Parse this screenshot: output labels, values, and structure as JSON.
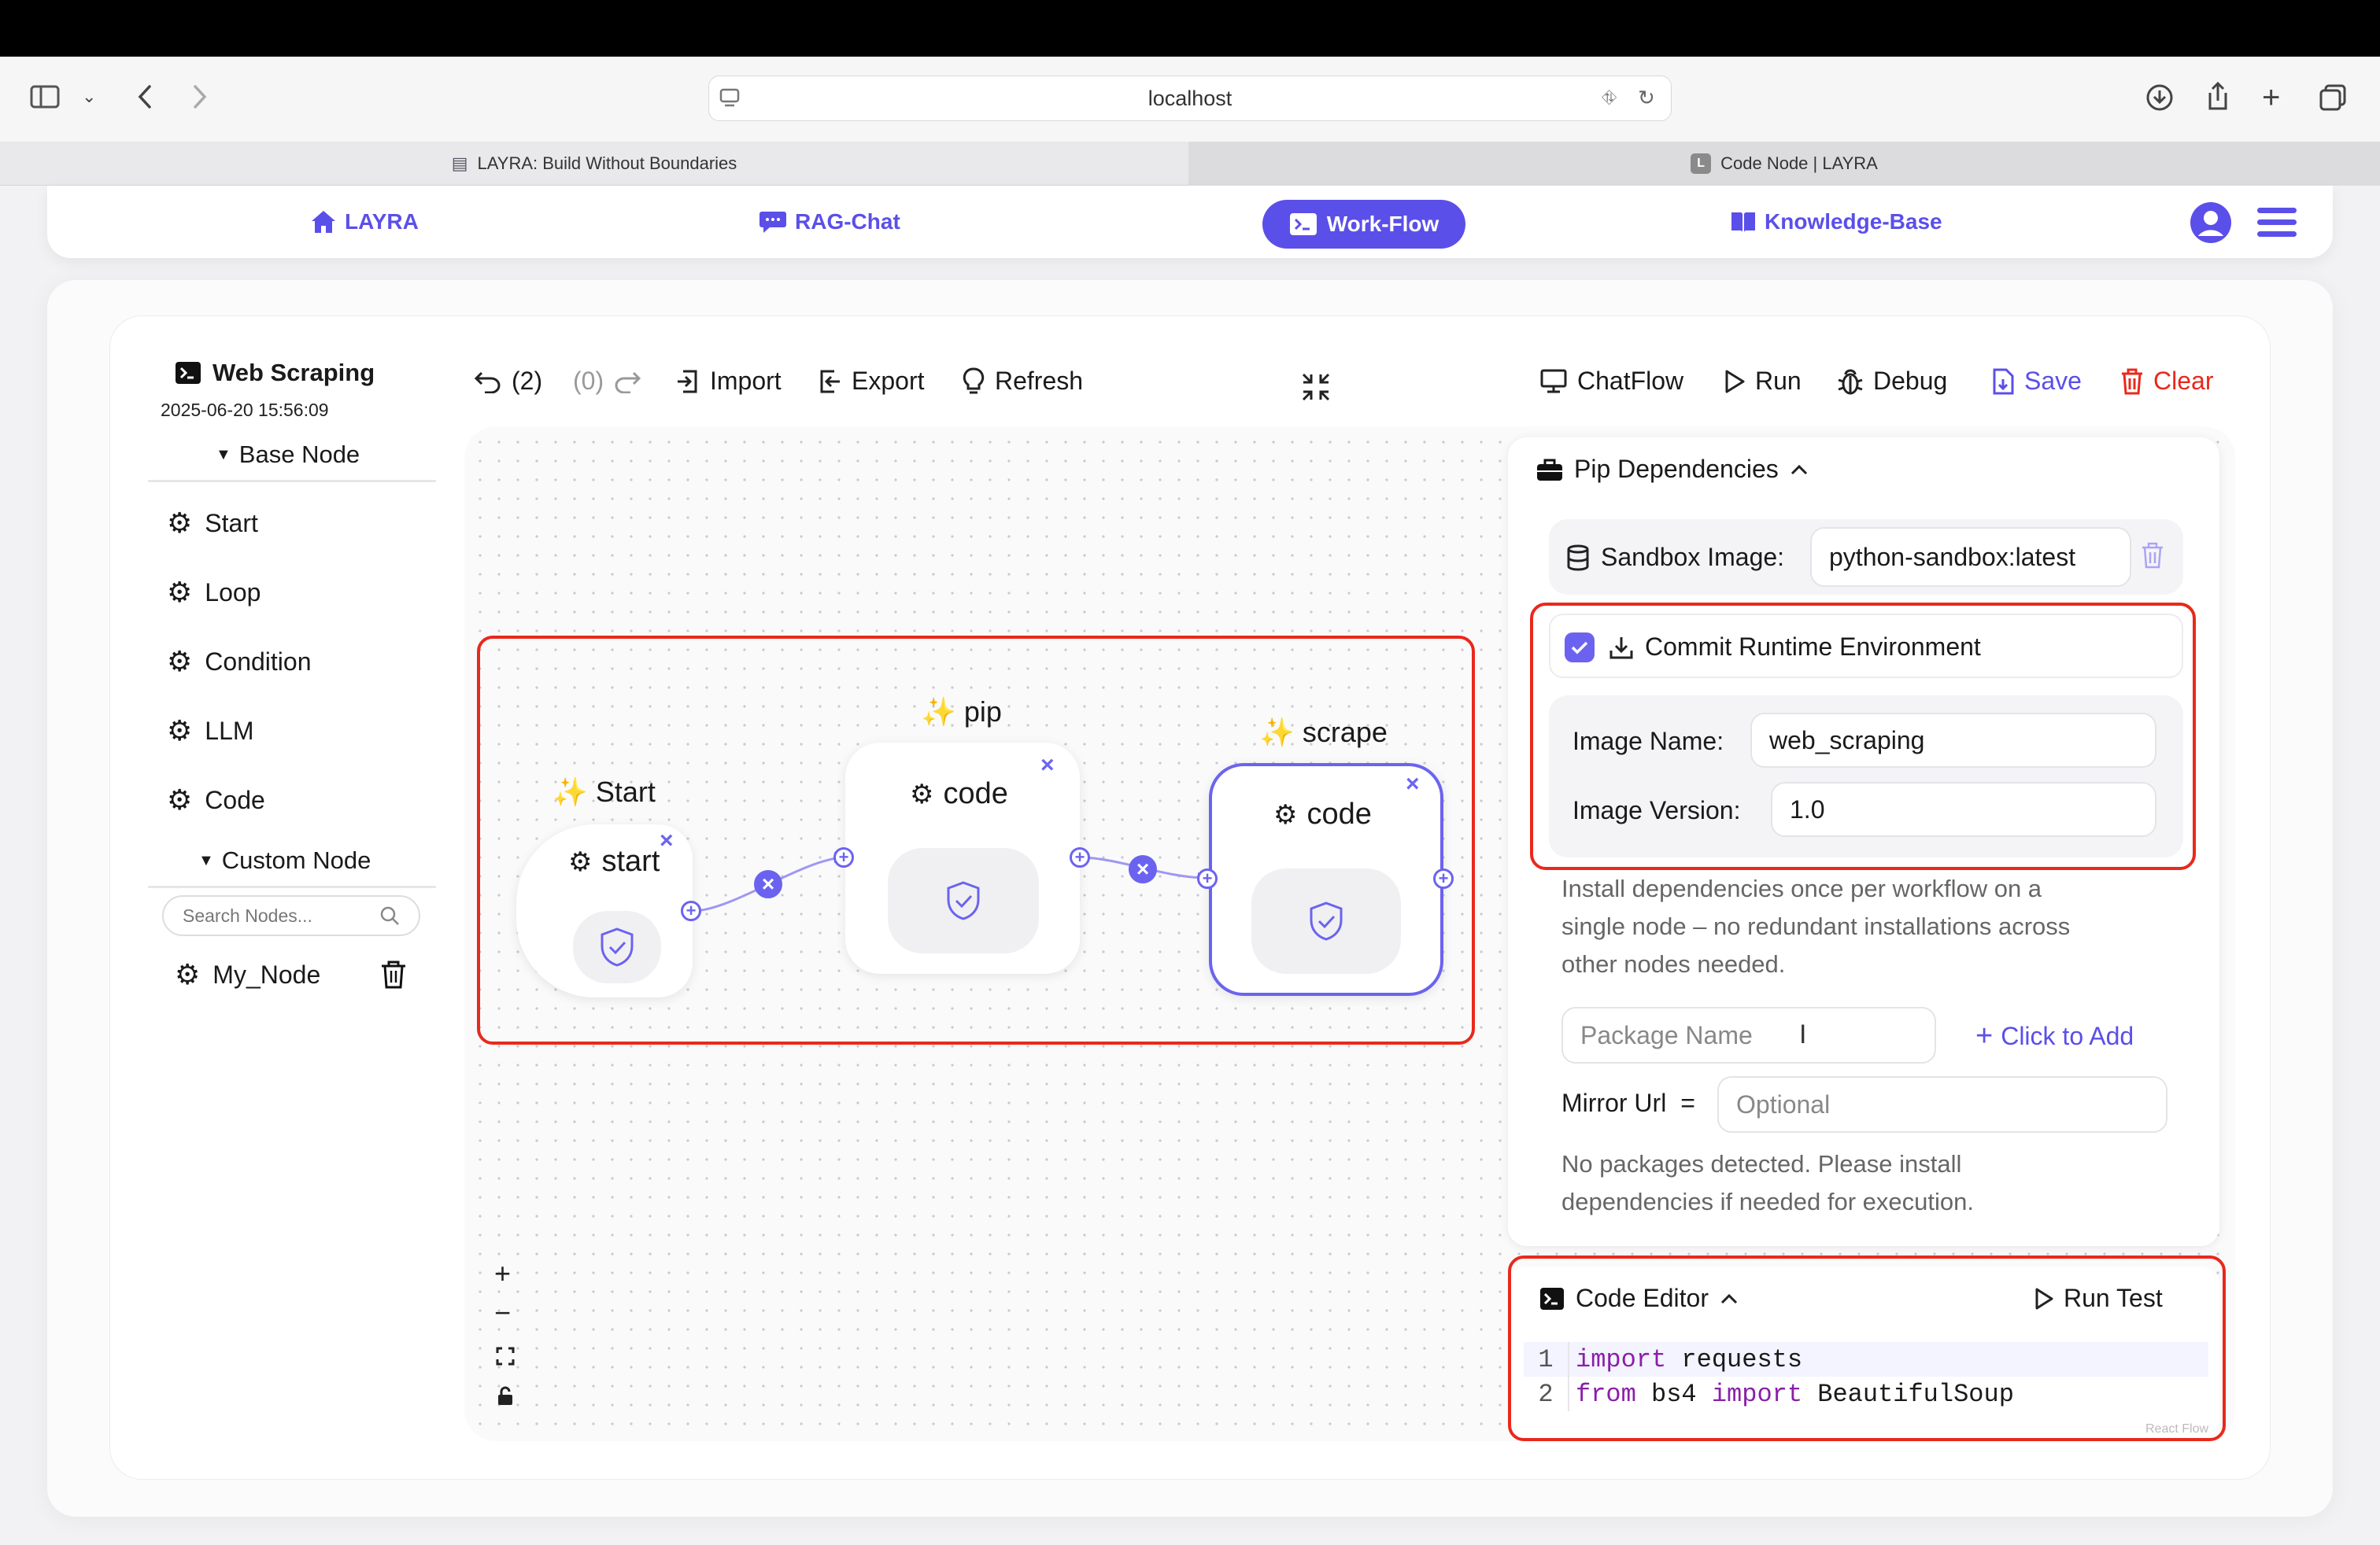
{
  "browser": {
    "url": "localhost",
    "tabs": [
      {
        "label": "LAYRA: Build Without Boundaries"
      },
      {
        "label": "Code Node | LAYRA",
        "favicon": "L"
      }
    ]
  },
  "nav": {
    "items": [
      {
        "label": "LAYRA",
        "icon": "home-icon"
      },
      {
        "label": "RAG-Chat",
        "icon": "chat-icon"
      },
      {
        "label": "Work-Flow",
        "icon": "terminal-icon",
        "active": true
      },
      {
        "label": "Knowledge-Base",
        "icon": "book-icon"
      }
    ],
    "accent": "#5b4fe9"
  },
  "sidebar": {
    "workflow_title": "Web Scraping",
    "timestamp": "2025-06-20 15:56:09",
    "base_section": "Base Node",
    "base_nodes": [
      "Start",
      "Loop",
      "Condition",
      "LLM",
      "Code"
    ],
    "custom_section": "Custom Node",
    "search_placeholder": "Search Nodes...",
    "custom_nodes": [
      "My_Node"
    ]
  },
  "toolbar": {
    "undo": "(2)",
    "redo": "(0)",
    "import": "Import",
    "export": "Export",
    "refresh": "Refresh",
    "chatflow": "ChatFlow",
    "run": "Run",
    "debug": "Debug",
    "save": "Save",
    "clear": "Clear",
    "clear_color": "#e8291c"
  },
  "graph": {
    "nodes": [
      {
        "title": "Start",
        "name": "start"
      },
      {
        "title": "pip",
        "name": "code"
      },
      {
        "title": "scrape",
        "name": "code",
        "selected": true
      }
    ]
  },
  "zoom_controls": {
    "zoom_in": "+",
    "zoom_out": "−"
  },
  "pip_panel": {
    "title": "Pip Dependencies",
    "sandbox_label": "Sandbox Image:",
    "sandbox_value": "python-sandbox:latest",
    "commit_label": "Commit Runtime Environment",
    "commit_checked": true,
    "image_name_label": "Image Name:",
    "image_name_value": "web_scraping",
    "image_version_label": "Image Version:",
    "image_version_value": "1.0",
    "hint_lines": [
      "Install dependencies once per workflow on a",
      "single node – no redundant installations across",
      "other nodes needed."
    ],
    "package_placeholder": "Package Name",
    "add_label": "Click to Add",
    "mirror_label": "Mirror Url",
    "mirror_eq": "=",
    "mirror_placeholder": "Optional",
    "empty_lines": [
      "No packages detected. Please install",
      "dependencies if needed for execution."
    ]
  },
  "code_editor": {
    "title": "Code Editor",
    "run_test": "Run Test",
    "lines": [
      {
        "no": "1",
        "kw1": "import",
        "rest1": " requests",
        "kw2": "",
        "rest2": ""
      },
      {
        "no": "2",
        "kw1": "from",
        "rest1": " bs4 ",
        "kw2": "import",
        "rest2": " BeautifulSoup"
      }
    ]
  },
  "watermark": "React Flow"
}
